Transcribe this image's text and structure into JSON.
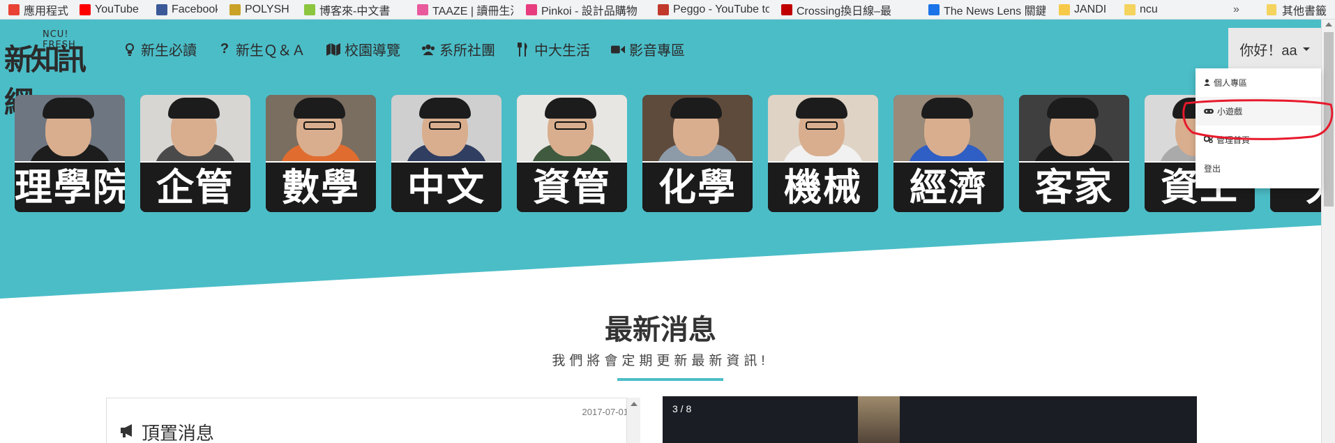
{
  "bookmarks": {
    "items": [
      {
        "label": "應用程式",
        "icon": "apps-grid-icon",
        "color": "#e94235"
      },
      {
        "label": "YouTube",
        "icon": "youtube-icon",
        "color": "#ff0000"
      },
      {
        "label": "Facebook",
        "icon": "facebook-icon",
        "color": "#3b5998"
      },
      {
        "label": "POLYSH",
        "icon": "polysh-icon",
        "color": "#c9a227"
      },
      {
        "label": "博客來-中文書",
        "icon": "books-icon",
        "color": "#8cc63f"
      },
      {
        "label": "TAAZE | 讀冊生活 – ",
        "icon": "taaze-icon",
        "color": "#e85a9c"
      },
      {
        "label": "Pinkoi - 設計品購物",
        "icon": "pinkoi-icon",
        "color": "#e73c7e"
      },
      {
        "label": "Peggo - YouTube to",
        "icon": "music-note-icon",
        "color": "#c0392b"
      },
      {
        "label": "Crossing換日線–最",
        "icon": "cw-icon",
        "color": "#c00000"
      },
      {
        "label": "The News Lens 關鍵",
        "icon": "newslens-icon",
        "color": "#1a73e8"
      },
      {
        "label": "JANDI",
        "icon": "jandi-icon",
        "color": "#f7c948"
      },
      {
        "label": "ncu",
        "icon": "folder-icon",
        "color": "#f4d35e"
      }
    ],
    "more": "»",
    "other": {
      "label": "其他書籤",
      "icon": "folder-icon",
      "color": "#f4d35e"
    }
  },
  "header": {
    "logo_big": "新知訊網",
    "logo_small": "NCU! FRESH",
    "nav": [
      {
        "label": "新生必讀",
        "icon": "lightbulb-icon"
      },
      {
        "label": "新生Ｑ＆Ａ",
        "icon": "question-icon"
      },
      {
        "label": "校園導覽",
        "icon": "map-icon"
      },
      {
        "label": "系所社團",
        "icon": "users-icon"
      },
      {
        "label": "中大生活",
        "icon": "utensils-icon"
      },
      {
        "label": "影音專區",
        "icon": "video-camera-icon"
      }
    ],
    "user_greeting": "你好！aa"
  },
  "dropdown": {
    "items": [
      {
        "label": "個人專區",
        "icon": "user-icon"
      },
      {
        "label": "小遊戲",
        "icon": "gamepad-icon"
      },
      {
        "label": "管理首頁",
        "icon": "cogs-icon"
      },
      {
        "label": "登出",
        "icon": ""
      }
    ]
  },
  "cards": [
    {
      "title": "理學院",
      "bg": "#6e7681",
      "shirt": "#1d1d1d",
      "glasses": false
    },
    {
      "title": "企管",
      "bg": "#d8d6d2",
      "shirt": "#4a4a4a",
      "glasses": false
    },
    {
      "title": "數學",
      "bg": "#7a6e60",
      "shirt": "#e06d2f",
      "glasses": true
    },
    {
      "title": "中文",
      "bg": "#cfcfcf",
      "shirt": "#2f3e61",
      "glasses": true
    },
    {
      "title": "資管",
      "bg": "#e8e6e2",
      "shirt": "#3f5a3f",
      "glasses": true
    },
    {
      "title": "化學",
      "bg": "#5e4b3c",
      "shirt": "#8d9aa8",
      "glasses": false
    },
    {
      "title": "機械",
      "bg": "#ded3c5",
      "shirt": "#f1f1f1",
      "glasses": true
    },
    {
      "title": "經濟",
      "bg": "#9a8a7a",
      "shirt": "#2f5ec4",
      "glasses": false
    },
    {
      "title": "客家",
      "bg": "#3f3f3f",
      "shirt": "#1c1c1c",
      "glasses": false
    },
    {
      "title": "資工",
      "bg": "#d9d9d9",
      "shirt": "#aaaaaa",
      "glasses": false
    },
    {
      "title": "大",
      "bg": "#8a6b54",
      "shirt": "#7a4a2a",
      "glasses": false
    }
  ],
  "news": {
    "title": "最新消息",
    "subtitle": "我們將會定期更新最新資訊!",
    "panel": {
      "date": "2017-07-01",
      "title": "頂置消息",
      "icon": "bullhorn-icon"
    },
    "slider_count": "3 / 8"
  },
  "colors": {
    "accent": "#4bbdc7",
    "annotation": "#e8192c"
  }
}
